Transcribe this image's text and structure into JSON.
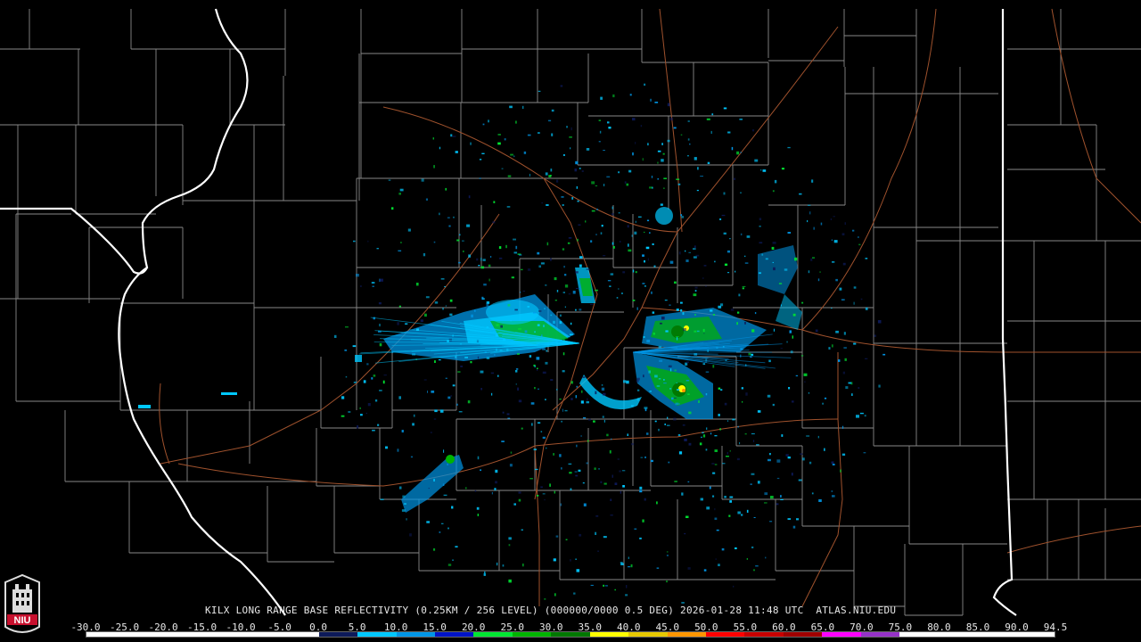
{
  "product": {
    "caption": "KILX LONG RANGE BASE REFLECTIVITY (0.25KM / 256 LEVEL) (000000/0000 0.5 DEG) 2026-01-28 11:48 UTC  ATLAS.NIU.EDU"
  },
  "logo": {
    "text": "NIU",
    "bg_color": "#c8102e"
  },
  "colorbar": {
    "labels": [
      "-30.0",
      "-25.0",
      "-20.0",
      "-15.0",
      "-10.0",
      "-5.0",
      "0.0",
      "5.0",
      "10.0",
      "15.0",
      "20.0",
      "25.0",
      "30.0",
      "35.0",
      "40.0",
      "45.0",
      "50.0",
      "55.0",
      "60.0",
      "65.0",
      "70.0",
      "75.0",
      "80.0",
      "85.0",
      "90.0",
      "94.5"
    ],
    "colors": [
      "#ffffff",
      "#ffffff",
      "#ffffff",
      "#ffffff",
      "#ffffff",
      "#ffffff",
      "#0d1a5a",
      "#00c8ff",
      "#0096e6",
      "#0014c8",
      "#00e632",
      "#00b400",
      "#007800",
      "#ffff00",
      "#e6c800",
      "#ff9600",
      "#ff0000",
      "#c80000",
      "#a00000",
      "#ff00ff",
      "#9632c8",
      "#ffffff",
      "#ffffff",
      "#ffffff",
      "#ffffff"
    ]
  },
  "map_style": {
    "background": "#000000",
    "county_line_color": "#888888",
    "state_line_color": "#ffffff",
    "highway_color": "#a0522d",
    "radar_site": "KILX"
  }
}
